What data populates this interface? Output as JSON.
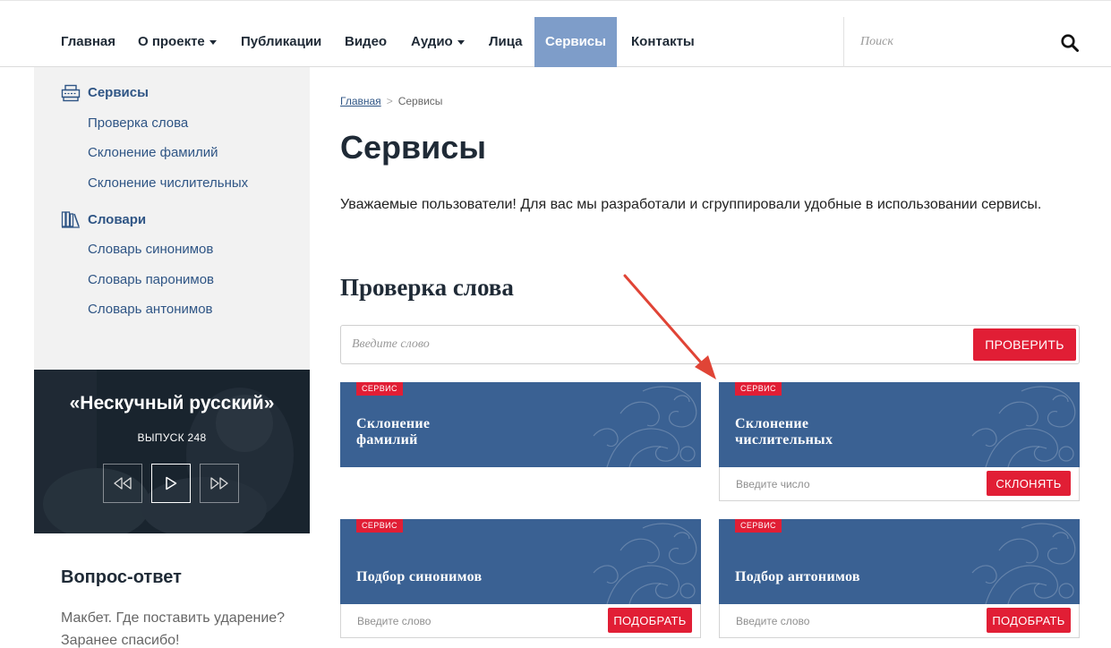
{
  "nav": {
    "items": [
      {
        "label": "Главная",
        "dropdown": false,
        "active": false
      },
      {
        "label": "О проекте",
        "dropdown": true,
        "active": false
      },
      {
        "label": "Публикации",
        "dropdown": false,
        "active": false
      },
      {
        "label": "Видео",
        "dropdown": false,
        "active": false
      },
      {
        "label": "Аудио",
        "dropdown": true,
        "active": false
      },
      {
        "label": "Лица",
        "dropdown": false,
        "active": false
      },
      {
        "label": "Сервисы",
        "dropdown": false,
        "active": true
      },
      {
        "label": "Контакты",
        "dropdown": false,
        "active": false
      }
    ],
    "search_placeholder": "Поиск"
  },
  "sidebar": {
    "groups": [
      {
        "title": "Сервисы",
        "icon": "typewriter-icon",
        "links": [
          "Проверка слова",
          "Склонение фамилий",
          "Склонение числительных"
        ]
      },
      {
        "title": "Словари",
        "icon": "books-icon",
        "links": [
          "Словарь синонимов",
          "Словарь паронимов",
          "Словарь антонимов"
        ]
      }
    ],
    "promo": {
      "title": "«Нескучный русский»",
      "issue": "ВЫПУСК 248"
    },
    "qa": {
      "title": "Вопрос-ответ",
      "text": "Макбет. Где поставить ударение? Заранее спасибо!"
    }
  },
  "breadcrumb": {
    "home": "Главная",
    "current": "Сервисы"
  },
  "main": {
    "title": "Сервисы",
    "intro": "Уважаемые пользователи! Для вас мы разработали и сгруппировали удобные в использовании сервисы.",
    "word_check": {
      "title": "Проверка слова",
      "placeholder": "Введите слово",
      "button": "ПРОВЕРИТЬ"
    },
    "cards": [
      {
        "badge": "СЕРВИС",
        "title_line1": "Склонение",
        "title_line2": "фамилий",
        "has_form": false
      },
      {
        "badge": "СЕРВИС",
        "title_line1": "Склонение",
        "title_line2": "числительных",
        "has_form": true,
        "placeholder": "Введите число",
        "button": "СКЛОНЯТЬ"
      },
      {
        "badge": "СЕРВИС",
        "title_line1": "Подбор синонимов",
        "title_line2": "",
        "has_form": true,
        "placeholder": "Введите слово",
        "button": "ПОДОБРАТЬ"
      },
      {
        "badge": "СЕРВИС",
        "title_line1": "Подбор антонимов",
        "title_line2": "",
        "has_form": true,
        "placeholder": "Введите слово",
        "button": "ПОДОБРАТЬ"
      }
    ]
  },
  "colors": {
    "brand_blue": "#3a6193",
    "nav_active": "#7e9dc9",
    "accent_red": "#e11e35",
    "annotation_arrow": "#e04436"
  }
}
